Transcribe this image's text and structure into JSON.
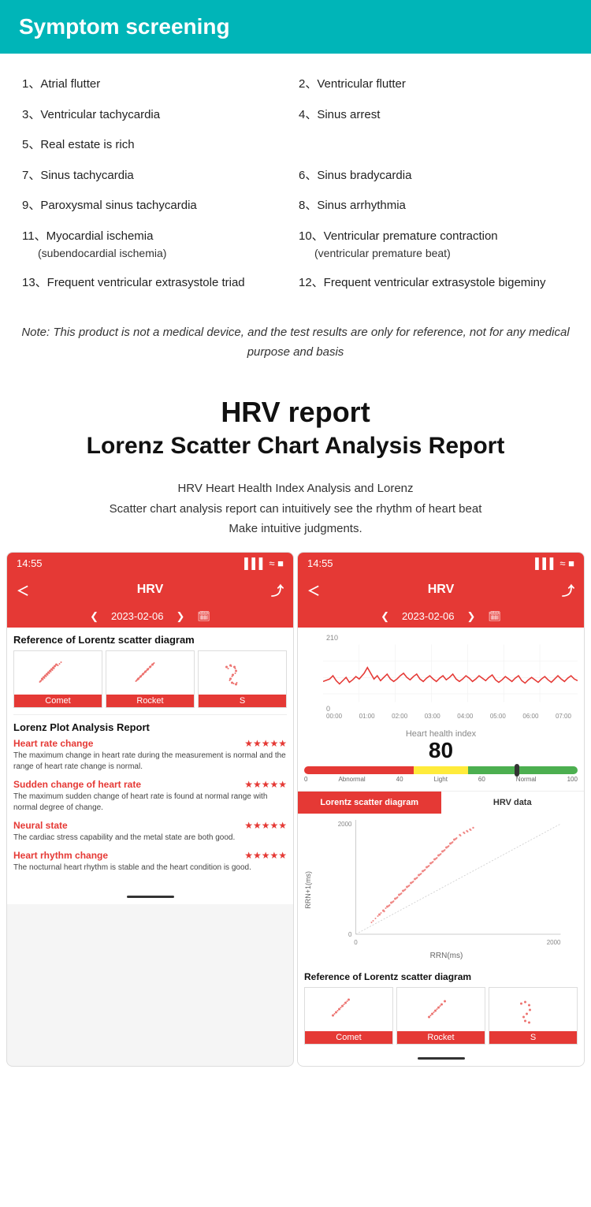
{
  "header": {
    "title": "Symptom screening"
  },
  "symptoms": {
    "items": [
      {
        "num": "1、",
        "text": "Atrial flutter",
        "col": "left"
      },
      {
        "num": "2、",
        "text": "Ventricular flutter",
        "col": "right"
      },
      {
        "num": "3、",
        "text": "Ventricular tachycardia",
        "col": "left"
      },
      {
        "num": "4、",
        "text": "Sinus arrest",
        "col": "right"
      },
      {
        "num": "5、",
        "text": "Real estate is rich",
        "col": "left"
      },
      {
        "num": "6、",
        "text": "Sinus bradycardia",
        "col": "right"
      },
      {
        "num": "7、",
        "text": "Sinus tachycardia",
        "col": "left"
      },
      {
        "num": "8、",
        "text": "Sinus arrhythmia",
        "col": "right"
      },
      {
        "num": "9、",
        "text": "Paroxysmal sinus tachycardia",
        "col": "left"
      },
      {
        "num": "10、",
        "text": "Ventricular premature contraction",
        "col": "right"
      },
      {
        "num": "11、",
        "text": "Myocardial ischemia",
        "sub": "(subendocardial ischemia)",
        "col": "left"
      },
      {
        "num": "",
        "text": "",
        "sub": "(ventricular premature beat)",
        "col": "right"
      },
      {
        "num": "13、",
        "text": "Frequent ventricular extrasystole triad",
        "col": "left"
      },
      {
        "num": "12、",
        "text": "Frequent ventricular extrasystole bigeminy",
        "col": "right"
      }
    ]
  },
  "note": {
    "text": "Note: This product is not a medical device, and the test results are only for reference, not for any medical purpose and basis"
  },
  "hrv_section": {
    "title1": "HRV report",
    "title2": "Lorenz Scatter Chart Analysis Report",
    "subtitle": "HRV Heart Health Index Analysis and Lorenz\nScatter chart analysis report can intuitively see the rhythm of heart beat\nMake intuitive judgments."
  },
  "phone_left": {
    "time": "14:55",
    "signals": "▌▌▌ ⇡ ▮",
    "back_arrow": "＜",
    "title": "HRV",
    "share_icon": "⤴",
    "date_prev": "❮",
    "date": "2023-02-06",
    "date_next": "❯",
    "calendar_icon": "📅",
    "scatter_ref_title": "Reference of Lorentz scatter diagram",
    "thumbnails": [
      {
        "label": "Comet"
      },
      {
        "label": "Rocket"
      },
      {
        "label": "S"
      }
    ],
    "lorenz_report_title": "Lorenz Plot Analysis Report",
    "metrics": [
      {
        "name": "Heart rate change",
        "stars": "★★★★★",
        "desc": "The maximum change in heart rate during the measurement is normal and the range of heart rate change is normal."
      },
      {
        "name": "Sudden change of heart rate",
        "stars": "★★★★★",
        "desc": "The maximum sudden change of heart rate is found at normal range with normal degree of change."
      },
      {
        "name": "Neural state",
        "stars": "★★★★★",
        "desc": "The cardiac stress capability and the metal state are both good."
      },
      {
        "name": "Heart rhythm change",
        "stars": "★★★★★",
        "desc": "The nocturnal heart rhythm is stable and the heart condition is good."
      }
    ]
  },
  "phone_right": {
    "time": "14:55",
    "signals": "▌▌▌ ⇡ ▮",
    "back_arrow": "＜",
    "title": "HRV",
    "share_icon": "⤴",
    "date_prev": "❮",
    "date": "2023-02-06",
    "date_next": "❯",
    "calendar_icon": "📅",
    "waveform_max": "210",
    "waveform_min": "0",
    "time_labels": [
      "00:00",
      "01:00",
      "02:00",
      "03:00",
      "04:00",
      "05:00",
      "06:00",
      "07:00"
    ],
    "heart_health_label": "Heart health index",
    "heart_health_value": "80",
    "bar_labels": [
      "0",
      "Abnormal",
      "40",
      "Light",
      "60",
      "Normal",
      "100"
    ],
    "tab_active": "Lorentz scatter diagram",
    "tab_inactive": "HRV data",
    "y_axis_max": "2000",
    "y_axis_min": "0",
    "x_axis_max": "2000",
    "x_axis_min": "0",
    "x_label": "RRN(ms)",
    "y_label": "RRN+1(ms)",
    "scatter_ref_title": "Reference of Lorentz scatter diagram"
  }
}
